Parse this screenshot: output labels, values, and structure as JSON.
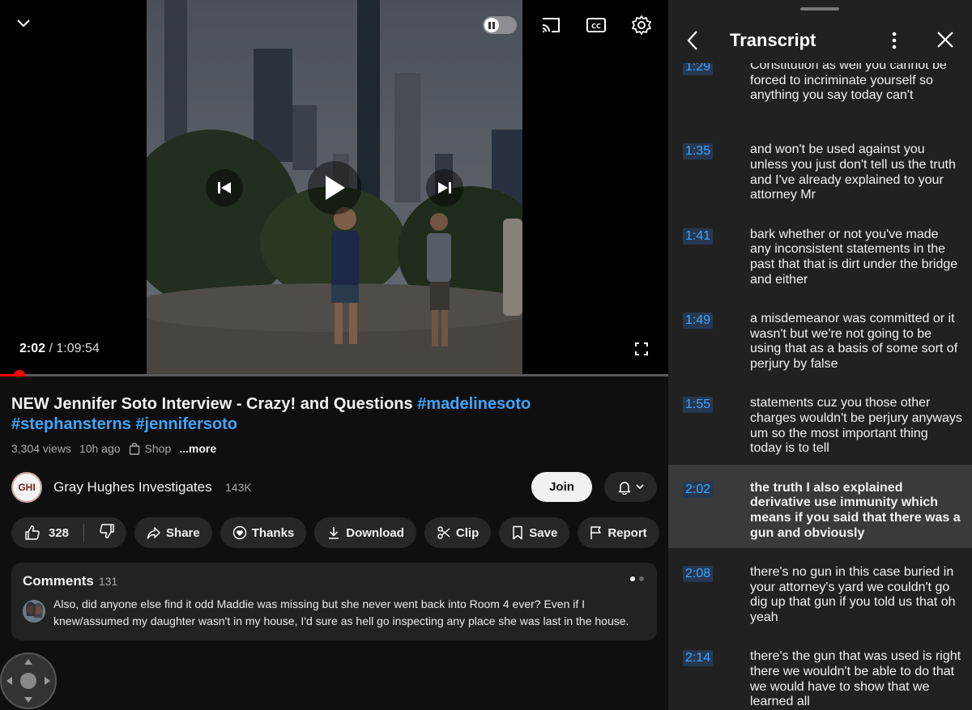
{
  "player": {
    "current_time": "2:02",
    "duration": "/ 1:09:54",
    "progress_fraction": 0.029
  },
  "video": {
    "title_plain": "NEW Jennifer Soto Interview - Crazy! and Questions ",
    "hashtag1": "#madelinesoto",
    "hashtag2": "#stephansterns",
    "hashtag3": "#jennifersoto",
    "views": "3,304 views",
    "age": "10h ago",
    "shop": "Shop",
    "more": "...more"
  },
  "channel": {
    "avatar_text": "GHI",
    "name": "Gray Hughes Investigates",
    "subscribers": "143K",
    "join_label": "Join"
  },
  "actions": {
    "likes": "328",
    "share": "Share",
    "thanks": "Thanks",
    "download": "Download",
    "clip": "Clip",
    "save": "Save",
    "report": "Report"
  },
  "comments": {
    "title": "Comments",
    "count": "131",
    "top_comment": "Also, did anyone else find it odd Maddie was missing but she never went back into Room 4 ever? Even if I knew/assumed my daughter wasn't in my house, I'd sure as hell go inspecting any place she was last in the house."
  },
  "transcript": {
    "title": "Transcript",
    "segments": [
      {
        "time": "1:29",
        "text": "Constitution as well you cannot be forced to incriminate yourself so anything you say today can't",
        "active": false
      },
      {
        "time": "1:35",
        "text": "and won't be used against you unless you just don't tell us the truth and I've already explained to your attorney Mr",
        "active": false
      },
      {
        "time": "1:41",
        "text": "bark whether or not you've made any inconsistent statements in the past that that is dirt under the bridge and either",
        "active": false
      },
      {
        "time": "1:49",
        "text": "a misdemeanor was committed or it wasn't but we're not going to be using that as a basis of some sort of perjury by false",
        "active": false
      },
      {
        "time": "1:55",
        "text": "statements cuz you those other charges wouldn't be perjury anyways um so the most important thing today is to tell",
        "active": false
      },
      {
        "time": "2:02",
        "text": "the truth I also explained derivative use immunity which means if you said that there was a gun and obviously",
        "active": true
      },
      {
        "time": "2:08",
        "text": "there's no gun in this case buried in your attorney's yard we couldn't go dig up that gun if you told us that oh yeah",
        "active": false
      },
      {
        "time": "2:14",
        "text": "there's the gun that was used is right there we wouldn't be able to do that we would have to show that we learned all",
        "active": false
      }
    ]
  },
  "colors": {
    "background": "#0f0f0f",
    "panel": "#212121",
    "accent_blue": "#3ea6ff",
    "progress_red": "#ff0000"
  }
}
